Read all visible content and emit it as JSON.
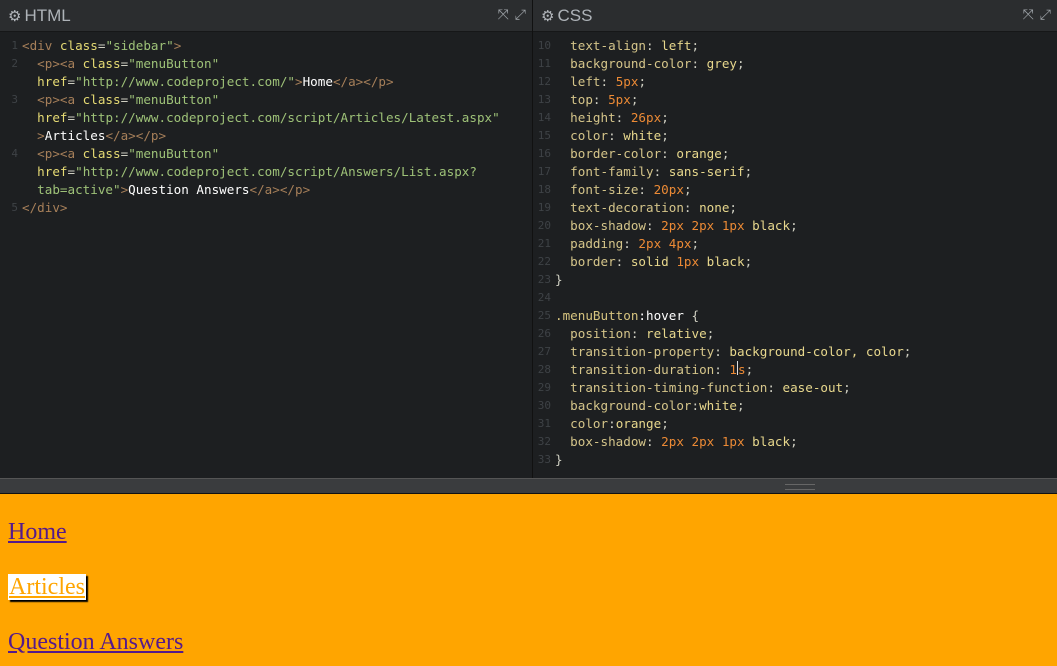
{
  "html_pane": {
    "title": "HTML",
    "lines": [
      {
        "n": "1",
        "tokens": [
          [
            "tag",
            "<div "
          ],
          [
            "attr",
            "class"
          ],
          [
            "punc",
            "="
          ],
          [
            "str",
            "\"sidebar\""
          ],
          [
            "tag",
            ">"
          ]
        ]
      },
      {
        "n": "2",
        "tokens": [
          [
            "txt",
            "  "
          ],
          [
            "tag",
            "<p><a "
          ],
          [
            "attr",
            "class"
          ],
          [
            "punc",
            "="
          ],
          [
            "str",
            "\"menuButton\""
          ]
        ]
      },
      {
        "n": "",
        "tokens": [
          [
            "txt",
            "  "
          ],
          [
            "attr",
            "href"
          ],
          [
            "punc",
            "="
          ],
          [
            "str",
            "\"http://www.codeproject.com/\""
          ],
          [
            "tag",
            ">"
          ],
          [
            "plain",
            "Home"
          ],
          [
            "tag",
            "</a></p>"
          ]
        ]
      },
      {
        "n": "3",
        "tokens": [
          [
            "txt",
            "  "
          ],
          [
            "tag",
            "<p><a "
          ],
          [
            "attr",
            "class"
          ],
          [
            "punc",
            "="
          ],
          [
            "str",
            "\"menuButton\""
          ]
        ]
      },
      {
        "n": "",
        "tokens": [
          [
            "txt",
            "  "
          ],
          [
            "attr",
            "href"
          ],
          [
            "punc",
            "="
          ],
          [
            "str",
            "\"http://www.codeproject.com/script/Articles/Latest.aspx\""
          ]
        ]
      },
      {
        "n": "",
        "tokens": [
          [
            "txt",
            "  "
          ],
          [
            "tag",
            ">"
          ],
          [
            "plain",
            "Articles"
          ],
          [
            "tag",
            "</a></p>"
          ]
        ]
      },
      {
        "n": "4",
        "tokens": [
          [
            "txt",
            "  "
          ],
          [
            "tag",
            "<p><a "
          ],
          [
            "attr",
            "class"
          ],
          [
            "punc",
            "="
          ],
          [
            "str",
            "\"menuButton\""
          ]
        ]
      },
      {
        "n": "",
        "tokens": [
          [
            "txt",
            "  "
          ],
          [
            "attr",
            "href"
          ],
          [
            "punc",
            "="
          ],
          [
            "str",
            "\"http://www.codeproject.com/script/Answers/List.aspx?"
          ]
        ]
      },
      {
        "n": "",
        "tokens": [
          [
            "txt",
            "  "
          ],
          [
            "str",
            "tab=active\""
          ],
          [
            "tag",
            ">"
          ],
          [
            "plain",
            "Question Answers"
          ],
          [
            "tag",
            "</a></p>"
          ]
        ]
      },
      {
        "n": "5",
        "tokens": [
          [
            "tag",
            "</div>"
          ]
        ]
      }
    ]
  },
  "css_pane": {
    "title": "CSS",
    "lines": [
      {
        "n": "10",
        "tokens": [
          [
            "txt",
            "  "
          ],
          [
            "prop",
            "text-align"
          ],
          [
            "punc",
            ": "
          ],
          [
            "val",
            "left"
          ],
          [
            "punc",
            ";"
          ]
        ]
      },
      {
        "n": "11",
        "tokens": [
          [
            "txt",
            "  "
          ],
          [
            "prop",
            "background-color"
          ],
          [
            "punc",
            ": "
          ],
          [
            "val",
            "grey"
          ],
          [
            "punc",
            ";"
          ]
        ]
      },
      {
        "n": "12",
        "tokens": [
          [
            "txt",
            "  "
          ],
          [
            "prop",
            "left"
          ],
          [
            "punc",
            ": "
          ],
          [
            "num",
            "5px"
          ],
          [
            "punc",
            ";"
          ]
        ]
      },
      {
        "n": "13",
        "tokens": [
          [
            "txt",
            "  "
          ],
          [
            "prop",
            "top"
          ],
          [
            "punc",
            ": "
          ],
          [
            "num",
            "5px"
          ],
          [
            "punc",
            ";"
          ]
        ]
      },
      {
        "n": "14",
        "tokens": [
          [
            "txt",
            "  "
          ],
          [
            "prop",
            "height"
          ],
          [
            "punc",
            ": "
          ],
          [
            "num",
            "26px"
          ],
          [
            "punc",
            ";"
          ]
        ]
      },
      {
        "n": "15",
        "tokens": [
          [
            "txt",
            "  "
          ],
          [
            "prop",
            "color"
          ],
          [
            "punc",
            ": "
          ],
          [
            "val",
            "white"
          ],
          [
            "punc",
            ";"
          ]
        ]
      },
      {
        "n": "16",
        "tokens": [
          [
            "txt",
            "  "
          ],
          [
            "prop",
            "border-color"
          ],
          [
            "punc",
            ": "
          ],
          [
            "val",
            "orange"
          ],
          [
            "punc",
            ";"
          ]
        ]
      },
      {
        "n": "17",
        "tokens": [
          [
            "txt",
            "  "
          ],
          [
            "prop",
            "font-family"
          ],
          [
            "punc",
            ": "
          ],
          [
            "val",
            "sans-serif"
          ],
          [
            "punc",
            ";"
          ]
        ]
      },
      {
        "n": "18",
        "tokens": [
          [
            "txt",
            "  "
          ],
          [
            "prop",
            "font-size"
          ],
          [
            "punc",
            ": "
          ],
          [
            "num",
            "20px"
          ],
          [
            "punc",
            ";"
          ]
        ]
      },
      {
        "n": "19",
        "tokens": [
          [
            "txt",
            "  "
          ],
          [
            "prop",
            "text-decoration"
          ],
          [
            "punc",
            ": "
          ],
          [
            "val",
            "none"
          ],
          [
            "punc",
            ";"
          ]
        ]
      },
      {
        "n": "20",
        "tokens": [
          [
            "txt",
            "  "
          ],
          [
            "prop",
            "box-shadow"
          ],
          [
            "punc",
            ": "
          ],
          [
            "num",
            "2px 2px 1px"
          ],
          [
            "val",
            " black"
          ],
          [
            "punc",
            ";"
          ]
        ]
      },
      {
        "n": "21",
        "tokens": [
          [
            "txt",
            "  "
          ],
          [
            "prop",
            "padding"
          ],
          [
            "punc",
            ": "
          ],
          [
            "num",
            "2px 4px"
          ],
          [
            "punc",
            ";"
          ]
        ]
      },
      {
        "n": "22",
        "tokens": [
          [
            "txt",
            "  "
          ],
          [
            "prop",
            "border"
          ],
          [
            "punc",
            ": "
          ],
          [
            "val",
            "solid "
          ],
          [
            "num",
            "1px"
          ],
          [
            "val",
            " black"
          ],
          [
            "punc",
            ";"
          ]
        ]
      },
      {
        "n": "23",
        "tokens": [
          [
            "punc",
            "}"
          ]
        ]
      },
      {
        "n": "24",
        "tokens": [
          [
            "txt",
            ""
          ]
        ]
      },
      {
        "n": "25",
        "tokens": [
          [
            "sel",
            ".menuButton"
          ],
          [
            "plain",
            ":hover"
          ],
          [
            "punc",
            " {"
          ]
        ]
      },
      {
        "n": "26",
        "tokens": [
          [
            "txt",
            "  "
          ],
          [
            "prop",
            "position"
          ],
          [
            "punc",
            ": "
          ],
          [
            "val",
            "relative"
          ],
          [
            "punc",
            ";"
          ]
        ]
      },
      {
        "n": "27",
        "tokens": [
          [
            "txt",
            "  "
          ],
          [
            "prop",
            "transition-property"
          ],
          [
            "punc",
            ": "
          ],
          [
            "val",
            "background-color, color"
          ],
          [
            "punc",
            ";"
          ]
        ]
      },
      {
        "n": "28",
        "tokens": [
          [
            "txt",
            "  "
          ],
          [
            "prop",
            "transition-duration"
          ],
          [
            "punc",
            ": "
          ],
          [
            "num",
            "1"
          ],
          [
            "cursor",
            ""
          ],
          [
            "num",
            "s"
          ],
          [
            "punc",
            ";"
          ]
        ]
      },
      {
        "n": "29",
        "tokens": [
          [
            "txt",
            "  "
          ],
          [
            "prop",
            "transition-timing-function"
          ],
          [
            "punc",
            ": "
          ],
          [
            "val",
            "ease-out"
          ],
          [
            "punc",
            ";"
          ]
        ]
      },
      {
        "n": "30",
        "tokens": [
          [
            "txt",
            "  "
          ],
          [
            "prop",
            "background-color"
          ],
          [
            "punc",
            ":"
          ],
          [
            "val",
            "white"
          ],
          [
            "punc",
            ";"
          ]
        ]
      },
      {
        "n": "31",
        "tokens": [
          [
            "txt",
            "  "
          ],
          [
            "prop",
            "color"
          ],
          [
            "punc",
            ":"
          ],
          [
            "val",
            "orange"
          ],
          [
            "punc",
            ";"
          ]
        ]
      },
      {
        "n": "32",
        "tokens": [
          [
            "txt",
            "  "
          ],
          [
            "prop",
            "box-shadow"
          ],
          [
            "punc",
            ": "
          ],
          [
            "num",
            "2px 2px 1px"
          ],
          [
            "val",
            " black"
          ],
          [
            "punc",
            ";"
          ]
        ]
      },
      {
        "n": "33",
        "tokens": [
          [
            "punc",
            "}"
          ]
        ]
      }
    ]
  },
  "pane_icons": [
    "gear-icon",
    "collapse-icon",
    "expand-icon"
  ],
  "preview": {
    "background": "#ffa500",
    "links": [
      {
        "label": "Home",
        "hover": false
      },
      {
        "label": "Articles",
        "hover": true
      },
      {
        "label": "Question Answers",
        "hover": false
      }
    ]
  }
}
